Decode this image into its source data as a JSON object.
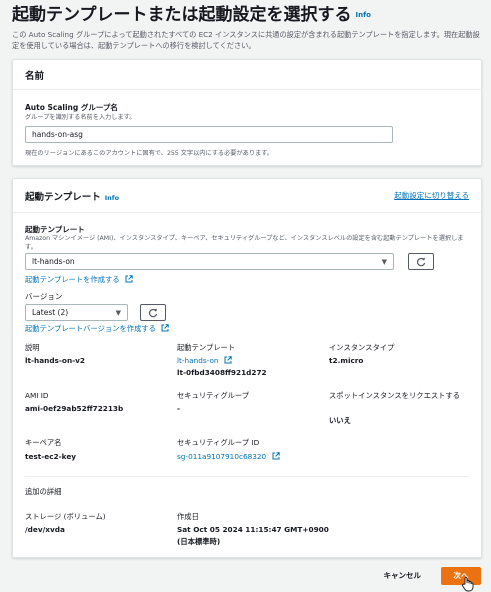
{
  "header": {
    "title": "起動テンプレートまたは起動設定を選択する",
    "info": "Info",
    "description": "この Auto Scaling グループによって起動されたすべての EC2 インスタンスに共通の設定が含まれる起動テンプレートを指定します。現在起動設定を使用している場合は、起動テンプレートへの移行を検討してください。"
  },
  "name_section": {
    "title": "名前",
    "group_label": "Auto Scaling グループ名",
    "group_hint": "グループを識別する名前を入力します。",
    "group_value": "hands-on-asg",
    "group_constraint": "現在のリージョンにあるこのアカウントに固有で、255 文字以内にする必要があります。"
  },
  "template_section": {
    "title": "起動テンプレート",
    "info": "Info",
    "switch_link": "起動設定に切り替える",
    "template_label": "起動テンプレート",
    "template_hint": "Amazon マシンイメージ (AMI)、インスタンスタイプ、キーペア、セキュリティグループなど、インスタンスレベルの設定を含む起動テンプレートを選択します。",
    "template_value": "lt-hands-on",
    "create_template_link": "起動テンプレートを作成する",
    "version_label": "バージョン",
    "version_value": "Latest (2)",
    "create_version_link": "起動テンプレートバージョンを作成する",
    "details": {
      "description_label": "説明",
      "description_value": "lt-hands-on-v2",
      "template_label": "起動テンプレート",
      "template_link": "lt-hands-on",
      "template_id": "lt-0fbd3408ff921d272",
      "instance_type_label": "インスタンスタイプ",
      "instance_type_value": "t2.micro",
      "ami_label": "AMI ID",
      "ami_value": "ami-0ef29ab52ff72213b",
      "sg_label": "セキュリティグループ",
      "sg_value": "-",
      "spot_label": "スポットインスタンスをリクエストする",
      "spot_value": "いいえ",
      "keypair_label": "キーペア名",
      "keypair_value": "test-ec2-key",
      "sg_id_label": "セキュリティグループ ID",
      "sg_id_value": "sg-011a9107910c68320"
    },
    "additional": {
      "title": "追加の詳細",
      "storage_label": "ストレージ (ボリューム)",
      "storage_value": "/dev/xvda",
      "created_label": "作成日",
      "created_value": "Sat Oct 05 2024 11:15:47 GMT+0900",
      "created_tz": "(日本標準時)"
    }
  },
  "footer": {
    "cancel": "キャンセル",
    "next": "次へ"
  },
  "colors": {
    "accent": "#ec7211",
    "link": "#0073bb"
  }
}
